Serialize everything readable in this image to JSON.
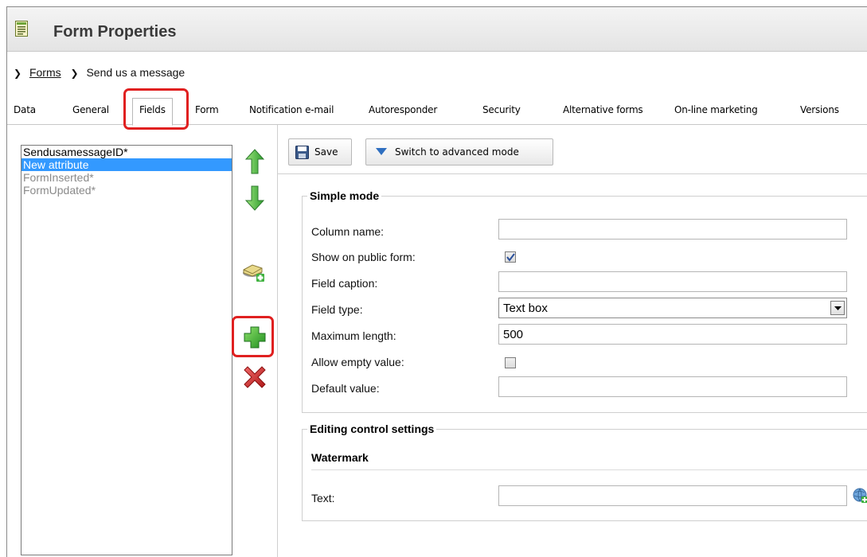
{
  "header": {
    "title": "Form Properties",
    "icon": "form-document-icon"
  },
  "breadcrumb": {
    "parent": "Forms",
    "current": "Send us a message"
  },
  "tabs": [
    {
      "label": "Data"
    },
    {
      "label": "General"
    },
    {
      "label": "Fields"
    },
    {
      "label": "Form"
    },
    {
      "label": "Notification e-mail"
    },
    {
      "label": "Autoresponder"
    },
    {
      "label": "Security"
    },
    {
      "label": "Alternative forms"
    },
    {
      "label": "On-line marketing"
    },
    {
      "label": "Versions"
    }
  ],
  "active_tab": "Fields",
  "fields_list": [
    {
      "label": "SendusamessageID*",
      "state": "normal"
    },
    {
      "label": "New attribute",
      "state": "selected"
    },
    {
      "label": "FormInserted*",
      "state": "system"
    },
    {
      "label": "FormUpdated*",
      "state": "system"
    }
  ],
  "toolbar": {
    "save_label": "Save",
    "advanced_label": "Switch to advanced mode"
  },
  "simple_mode": {
    "legend": "Simple mode",
    "column_name_label": "Column name:",
    "column_name_value": "",
    "show_on_public_label": "Show on public form:",
    "show_on_public_checked": true,
    "field_caption_label": "Field caption:",
    "field_caption_value": "",
    "field_type_label": "Field type:",
    "field_type_value": "Text box",
    "max_length_label": "Maximum length:",
    "max_length_value": "500",
    "allow_empty_label": "Allow empty value:",
    "allow_empty_checked": false,
    "default_value_label": "Default value:",
    "default_value_value": ""
  },
  "editing_control": {
    "legend": "Editing control settings",
    "watermark_heading": "Watermark",
    "text_label": "Text:",
    "text_value": ""
  },
  "colors": {
    "selection": "#3399ff",
    "highlight_outline": "#e02020",
    "green_arrow": "#3fbf3f",
    "delete_red": "#d9262b"
  }
}
